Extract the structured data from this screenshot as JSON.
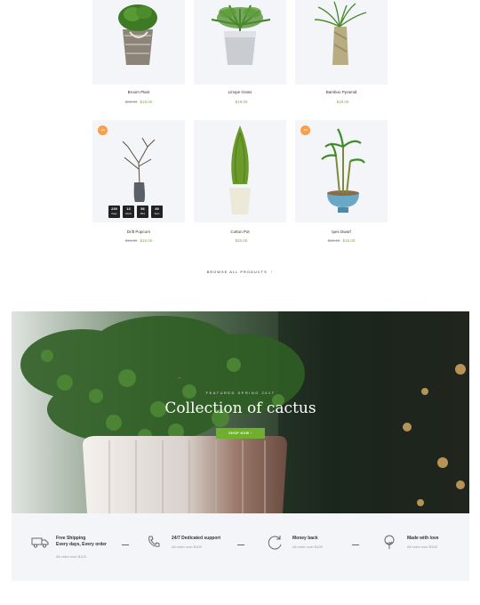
{
  "products": [
    {
      "name": "Broom Plant",
      "old_price": "$25.00",
      "price": "$18.00",
      "badge": ""
    },
    {
      "name": "Liriope Grass",
      "old_price": "",
      "price": "$19.00",
      "badge": ""
    },
    {
      "name": "Bamboo Pyramid",
      "old_price": "",
      "price": "$18.00",
      "badge": ""
    },
    {
      "name": "Drift Popcorn",
      "old_price": "$16.00",
      "price": "$16.00",
      "badge": "-4%"
    },
    {
      "name": "Cotton Pot",
      "old_price": "",
      "price": "$20.00",
      "badge": ""
    },
    {
      "name": "Ipes Dwarf",
      "old_price": "$22.00",
      "price": "$18.00",
      "badge": "-5%"
    }
  ],
  "countdown": [
    {
      "value": "239",
      "label": "Days"
    },
    {
      "value": "13",
      "label": "Hours"
    },
    {
      "value": "56",
      "label": "Mins"
    },
    {
      "value": "49",
      "label": "Secs"
    }
  ],
  "browse_label": "BROWSE ALL PRODUCTS",
  "banner": {
    "subtitle": "FEATURED SPRING 2017",
    "title": "Collection of cactus",
    "button": "SHOP NOW"
  },
  "features": [
    {
      "title": "Free Shipping",
      "title2": "Every days, Every order",
      "subtitle": "All order over $100",
      "icon": "truck-icon"
    },
    {
      "title": "24/7 Dedicated support",
      "title2": "",
      "subtitle": "All order over $100",
      "icon": "phone-icon"
    },
    {
      "title": "Money back",
      "title2": "",
      "subtitle": "All order over $100",
      "icon": "refresh-icon"
    },
    {
      "title": "Made with love",
      "title2": "",
      "subtitle": "All order over $100",
      "icon": "tree-icon"
    }
  ],
  "colors": {
    "accent": "#7cb342",
    "badge": "#f6a04d",
    "panel": "#f4f5f9"
  }
}
